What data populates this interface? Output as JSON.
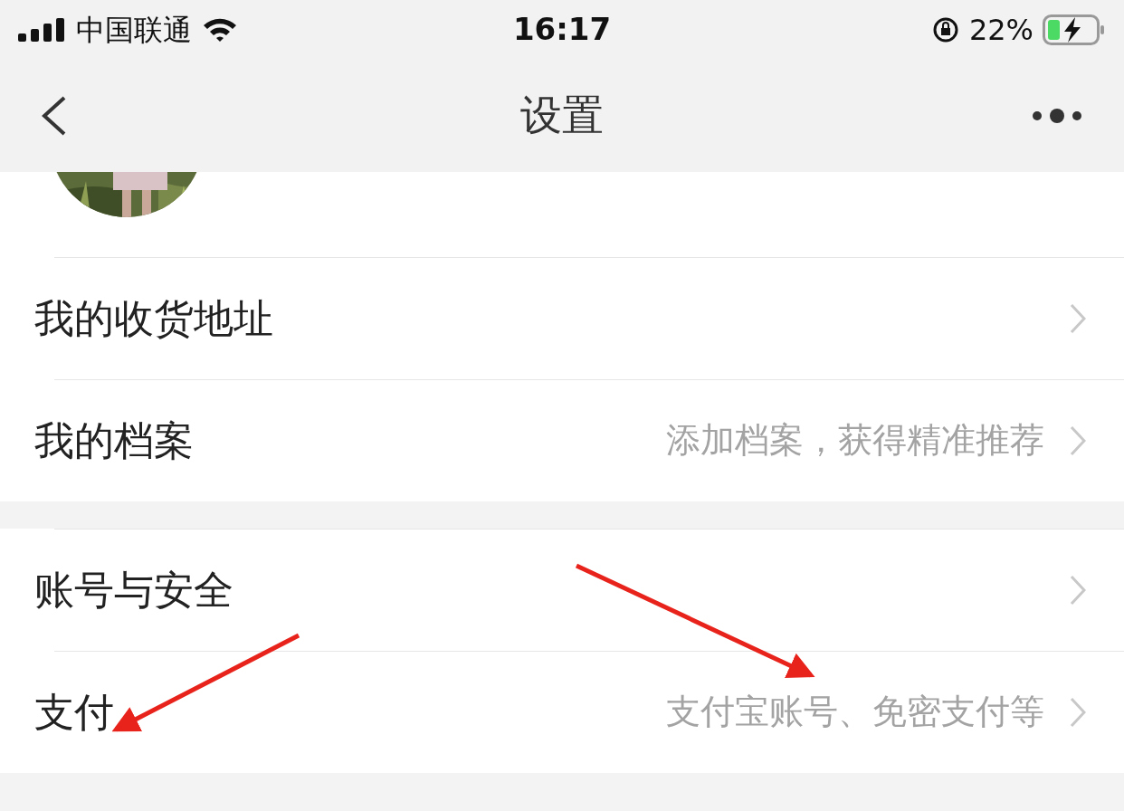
{
  "status_bar": {
    "carrier": "中国联通",
    "time": "16:17",
    "battery": "22%"
  },
  "nav": {
    "title": "设置"
  },
  "sections": [
    {
      "rows": [
        {
          "label": "我的收货地址"
        },
        {
          "label": "我的档案",
          "value": "添加档案，获得精准推荐"
        }
      ]
    },
    {
      "rows": [
        {
          "label": "账号与安全"
        },
        {
          "label": "支付",
          "value": "支付宝账号、免密支付等"
        }
      ]
    }
  ]
}
